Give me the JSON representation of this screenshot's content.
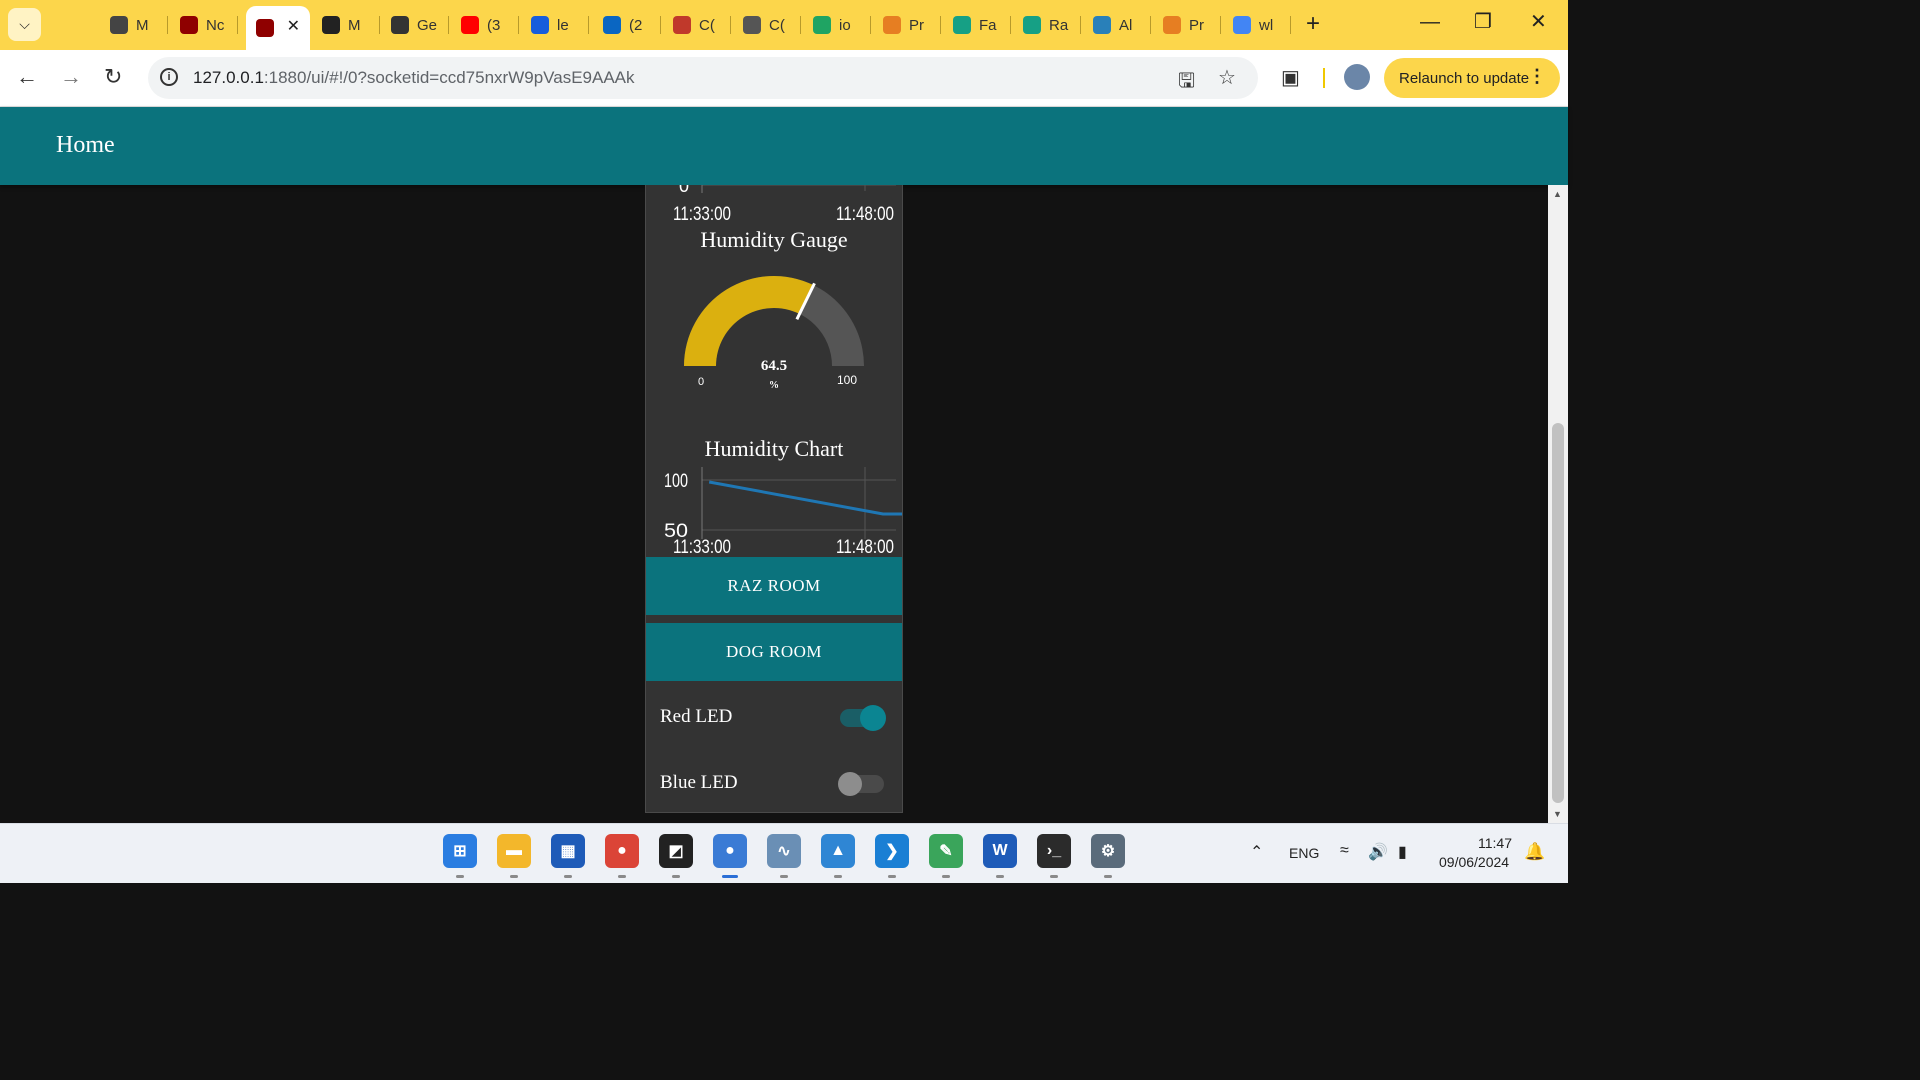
{
  "browser": {
    "tabs": [
      {
        "label": "M",
        "icon": "openai-icon",
        "color": "#444444"
      },
      {
        "label": "Nc",
        "icon": "node-red-icon",
        "color": "#8f0000"
      },
      {
        "label": "",
        "icon": "node-red-flow-icon",
        "color": "#8f0000",
        "active": true
      },
      {
        "label": "M",
        "icon": "wikipedia-icon",
        "color": "#222222"
      },
      {
        "label": "Ge",
        "icon": "bee-icon",
        "color": "#333333"
      },
      {
        "label": "(3",
        "icon": "youtube-icon",
        "color": "#ff0000"
      },
      {
        "label": "le",
        "icon": "bitwarden-icon",
        "color": "#175ddc"
      },
      {
        "label": "(2",
        "icon": "linkedin-icon",
        "color": "#0a66c2"
      },
      {
        "label": "C(",
        "icon": "mcafee-icon",
        "color": "#c0392b"
      },
      {
        "label": "C(",
        "icon": "globe-icon",
        "color": "#555555"
      },
      {
        "label": "io",
        "icon": "google-drive-icon",
        "color": "#1fa463"
      },
      {
        "label": "Pr",
        "icon": "coursera-icon",
        "color": "#e67e22"
      },
      {
        "label": "Fa",
        "icon": "feather-icon",
        "color": "#16a085"
      },
      {
        "label": "Ra",
        "icon": "feather-icon",
        "color": "#16a085"
      },
      {
        "label": "Al",
        "icon": "brain-icon",
        "color": "#2980b9"
      },
      {
        "label": "Pr",
        "icon": "coursera-icon",
        "color": "#e67e22"
      },
      {
        "label": "wl",
        "icon": "google-icon",
        "color": "#4285f4"
      }
    ],
    "url_host": "127.0.0.1",
    "url_path": ":1880/ui/#!/0?socketid=ccd75nxrW9pVasE9AAAk",
    "relaunch_label": "Relaunch to update"
  },
  "dashboard": {
    "header_title": "Home",
    "top_chart": {
      "y_tick": "0",
      "x_ticks": [
        "11:33:00",
        "11:48:00"
      ]
    },
    "gauge": {
      "title": "Humidity Gauge",
      "value": 64.5,
      "value_label": "64.5",
      "units": "%",
      "min": 0,
      "max": 100,
      "min_label": "0",
      "max_label": "100",
      "color": "#dbb00f"
    },
    "humidity_chart": {
      "title": "Humidity Chart",
      "y_ticks": [
        "100",
        "50"
      ],
      "x_ticks": [
        "11:33:00",
        "11:48:00"
      ],
      "line_color": "#1f77b4"
    },
    "buttons": [
      "RAZ ROOM",
      "DOG ROOM"
    ],
    "switches": [
      {
        "label": "Red LED",
        "state": "on"
      },
      {
        "label": "Blue LED",
        "state": "off"
      }
    ]
  },
  "chart_data": [
    {
      "type": "gauge",
      "title": "Humidity Gauge",
      "value": 64.5,
      "min": 0,
      "max": 100,
      "units": "%"
    },
    {
      "type": "line",
      "title": "Humidity Chart",
      "x": [
        "11:30:00",
        "11:46:00",
        "11:48:00"
      ],
      "series": [
        {
          "values": [
            98,
            66,
            66
          ]
        }
      ],
      "ylim": [
        40,
        105
      ],
      "x_ticks": [
        "11:33:00",
        "11:48:00"
      ],
      "y_ticks": [
        50,
        100
      ],
      "grid": true
    }
  ],
  "taskbar": {
    "apps": [
      {
        "name": "windows-start-icon",
        "color": "#2a7de1",
        "glyph": "⊞"
      },
      {
        "name": "file-explorer-icon",
        "color": "#f3b72b",
        "glyph": "▬"
      },
      {
        "name": "microsoft-store-icon",
        "color": "#1e5bb8",
        "glyph": "▦"
      },
      {
        "name": "chrome-icon",
        "color": "#db4437",
        "glyph": "●"
      },
      {
        "name": "sticky-notes-icon",
        "color": "#222222",
        "glyph": "◩"
      },
      {
        "name": "chrome-dev-icon",
        "color": "#3a7bd5",
        "glyph": "●",
        "active": true
      },
      {
        "name": "resource-monitor-icon",
        "color": "#6a8fb5",
        "glyph": "∿"
      },
      {
        "name": "photos-icon",
        "color": "#2f86d4",
        "glyph": "▲"
      },
      {
        "name": "vs-code-icon",
        "color": "#1a7fd4",
        "glyph": "❯"
      },
      {
        "name": "thonny-icon",
        "color": "#3aa55b",
        "glyph": "✎"
      },
      {
        "name": "word-icon",
        "color": "#1e5bb8",
        "glyph": "W"
      },
      {
        "name": "terminal-icon",
        "color": "#2b2b2b",
        "glyph": "›_"
      },
      {
        "name": "settings-icon",
        "color": "#5a6b7b",
        "glyph": "⚙"
      }
    ],
    "language": "ENG",
    "time": "11:47",
    "date": "09/06/2024"
  }
}
